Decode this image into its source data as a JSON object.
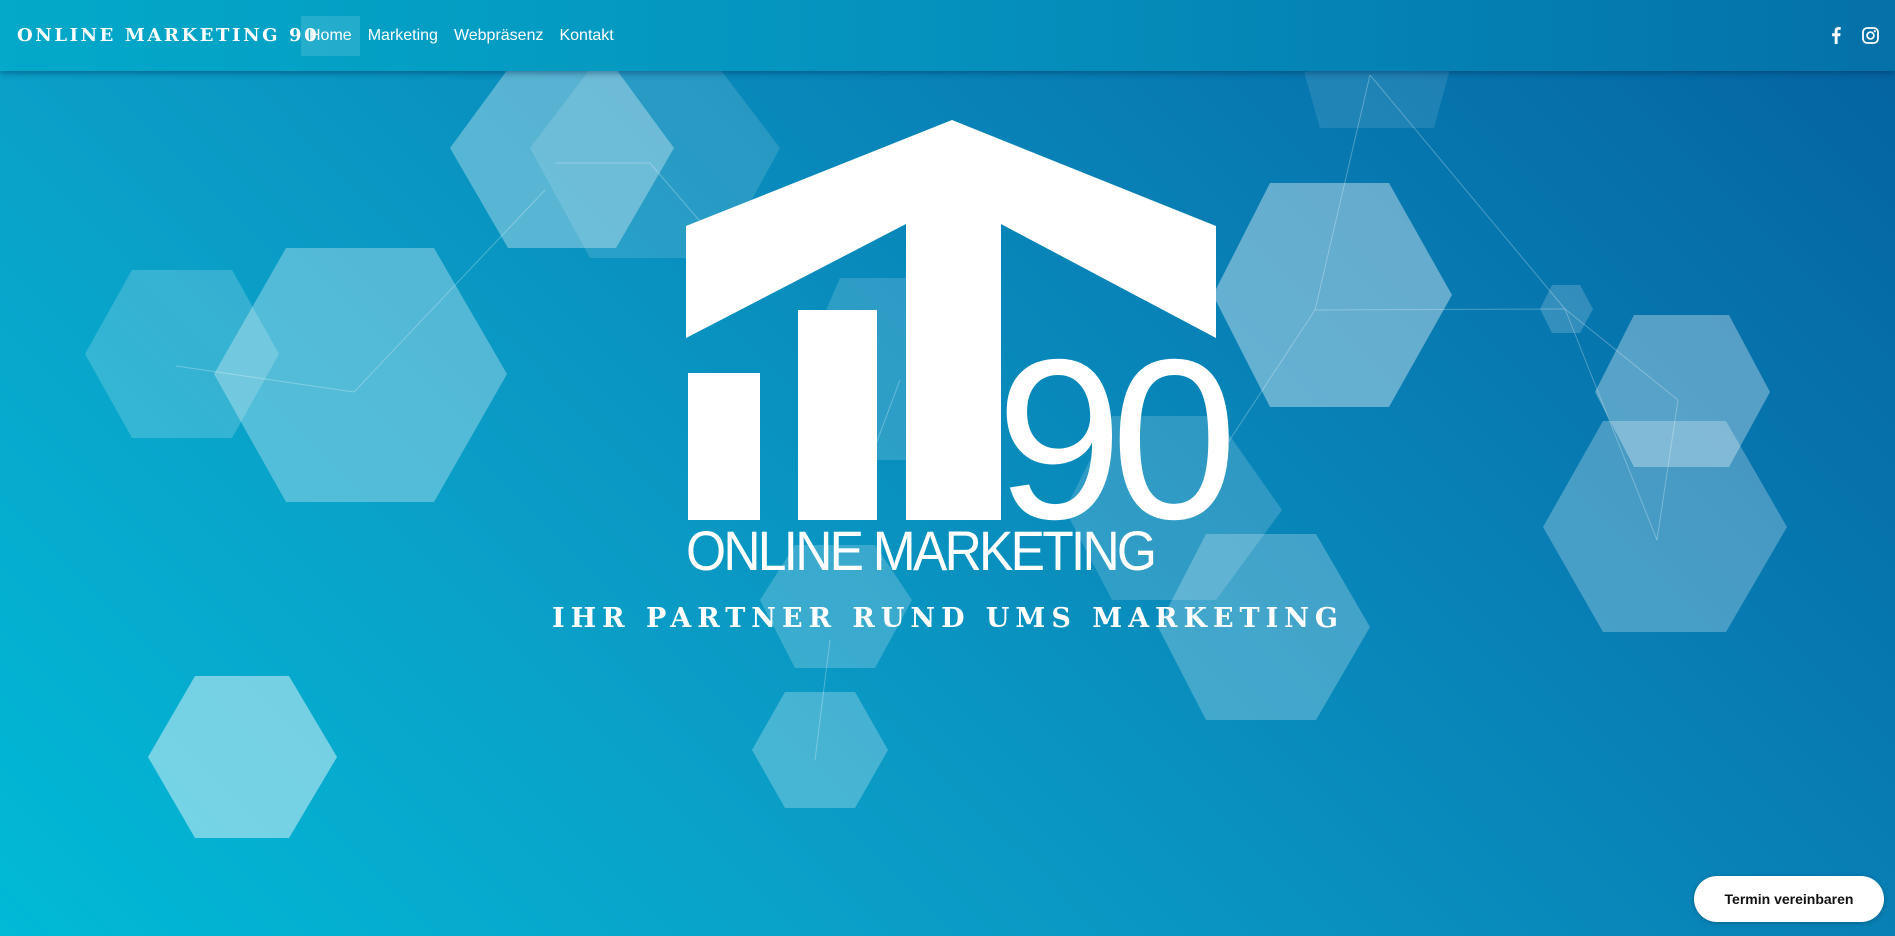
{
  "header": {
    "brand": "ONLINE MARKETING 90",
    "nav": [
      {
        "label": "Home",
        "active": true
      },
      {
        "label": "Marketing",
        "active": false
      },
      {
        "label": "Webpräsenz",
        "active": false
      },
      {
        "label": "Kontakt",
        "active": false
      }
    ],
    "social": [
      {
        "icon": "facebook-icon"
      },
      {
        "icon": "instagram-icon"
      }
    ]
  },
  "hero": {
    "logo": {
      "number": "90",
      "subtitle": "ONLINE MARKETING"
    },
    "tagline": "IHR PARTNER RUND UMS MARKETING"
  },
  "cta": {
    "label": "Termin vereinbaren"
  },
  "colors": {
    "accent_light": "#00bad6",
    "accent_dark": "#0462a0",
    "text": "#ffffff",
    "cta_background": "#ffffff"
  }
}
